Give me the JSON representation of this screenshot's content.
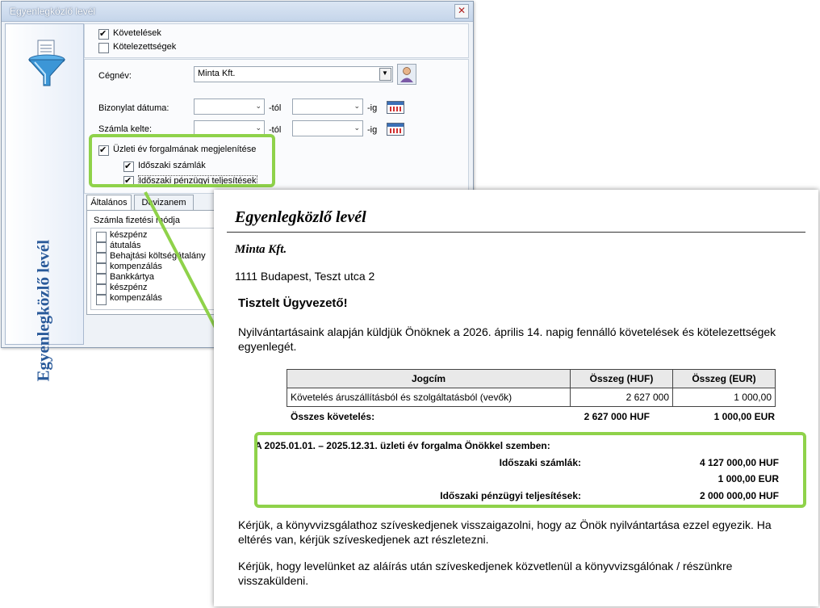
{
  "window": {
    "title": "Egyenlegközlő levél",
    "close_glyph": "✕",
    "side_label": "Egyenlegközlő levél",
    "icon": "filter-funnel-icon"
  },
  "filters": {
    "kovetelesek": {
      "label": "Követelések",
      "checked": true
    },
    "kotelezettsegek": {
      "label": "Kötelezettségek",
      "checked": false
    },
    "cegnev_label": "Cégnév:",
    "cegnev_value": "Minta Kft.",
    "bizonylat_label": "Bizonylat dátuma:",
    "szamla_label": "Számla kelte:",
    "tol": "-tól",
    "ig": "-ig",
    "uzleti_ev": {
      "label": "Üzleti év forgalmának megjelenítése",
      "checked": true
    },
    "idoszaki_szamlak": {
      "label": "Időszaki számlák",
      "checked": true
    },
    "idoszaki_penzugyi": {
      "label": "Időszaki pénzügyi teljesítések",
      "checked": true
    }
  },
  "tabs": [
    "Általános",
    "Devizanem"
  ],
  "payment": {
    "title": "Számla fizetési módja",
    "items": [
      "készpénz",
      "átutalás",
      "Behajtási költségátalány",
      "kompenzálás",
      "Bankkártya",
      "készpénz",
      "kompenzálás"
    ]
  },
  "letter": {
    "title": "Egyenlegközlő levél",
    "company": "Minta Kft.",
    "address": "1111 Budapest, Teszt  utca 2",
    "greeting": "Tisztelt Ügyvezető!",
    "intro": "Nyilvántartásaink alapján küldjük Önöknek a 2026. április 14. napig fennálló követelések és kötelezettségek egyenlegét.",
    "table": {
      "headers": [
        "Jogcím",
        "Összeg (HUF)",
        "Összeg (EUR)"
      ],
      "rows": [
        [
          "Követelés áruszállításból és szolgáltatásból (vevők)",
          "2 627 000",
          "1 000,00"
        ]
      ],
      "total_label": "Összes követelés:",
      "total_huf": "2 627 000 HUF",
      "total_eur": "1 000,00 EUR"
    },
    "turnover": {
      "heading": "A 2025.01.01. – 2025.12.31. üzleti év forgalma Önökkel szemben:",
      "szamlak_label": "Időszaki számlák:",
      "szamlak_huf": "4 127 000,00 HUF",
      "szamlak_eur": "1 000,00 EUR",
      "penzugyi_label": "Időszaki pénzügyi teljesítések:",
      "penzugyi_huf": "2 000 000,00 HUF"
    },
    "para1": "Kérjük, a könyvvizsgálathoz szíveskedjenek visszaigazolni, hogy az Önök nyilvántartása ezzel egyezik. Ha eltérés van, kérjük szíveskedjenek azt részletezni.",
    "para2": "Kérjük, hogy levelünket az aláírás után szíveskedjenek közvetlenül a könyvvizsgálónak / részünkre visszaküldeni."
  },
  "colors": {
    "highlight": "#8fd24a",
    "side_label": "#2a5a9a"
  }
}
